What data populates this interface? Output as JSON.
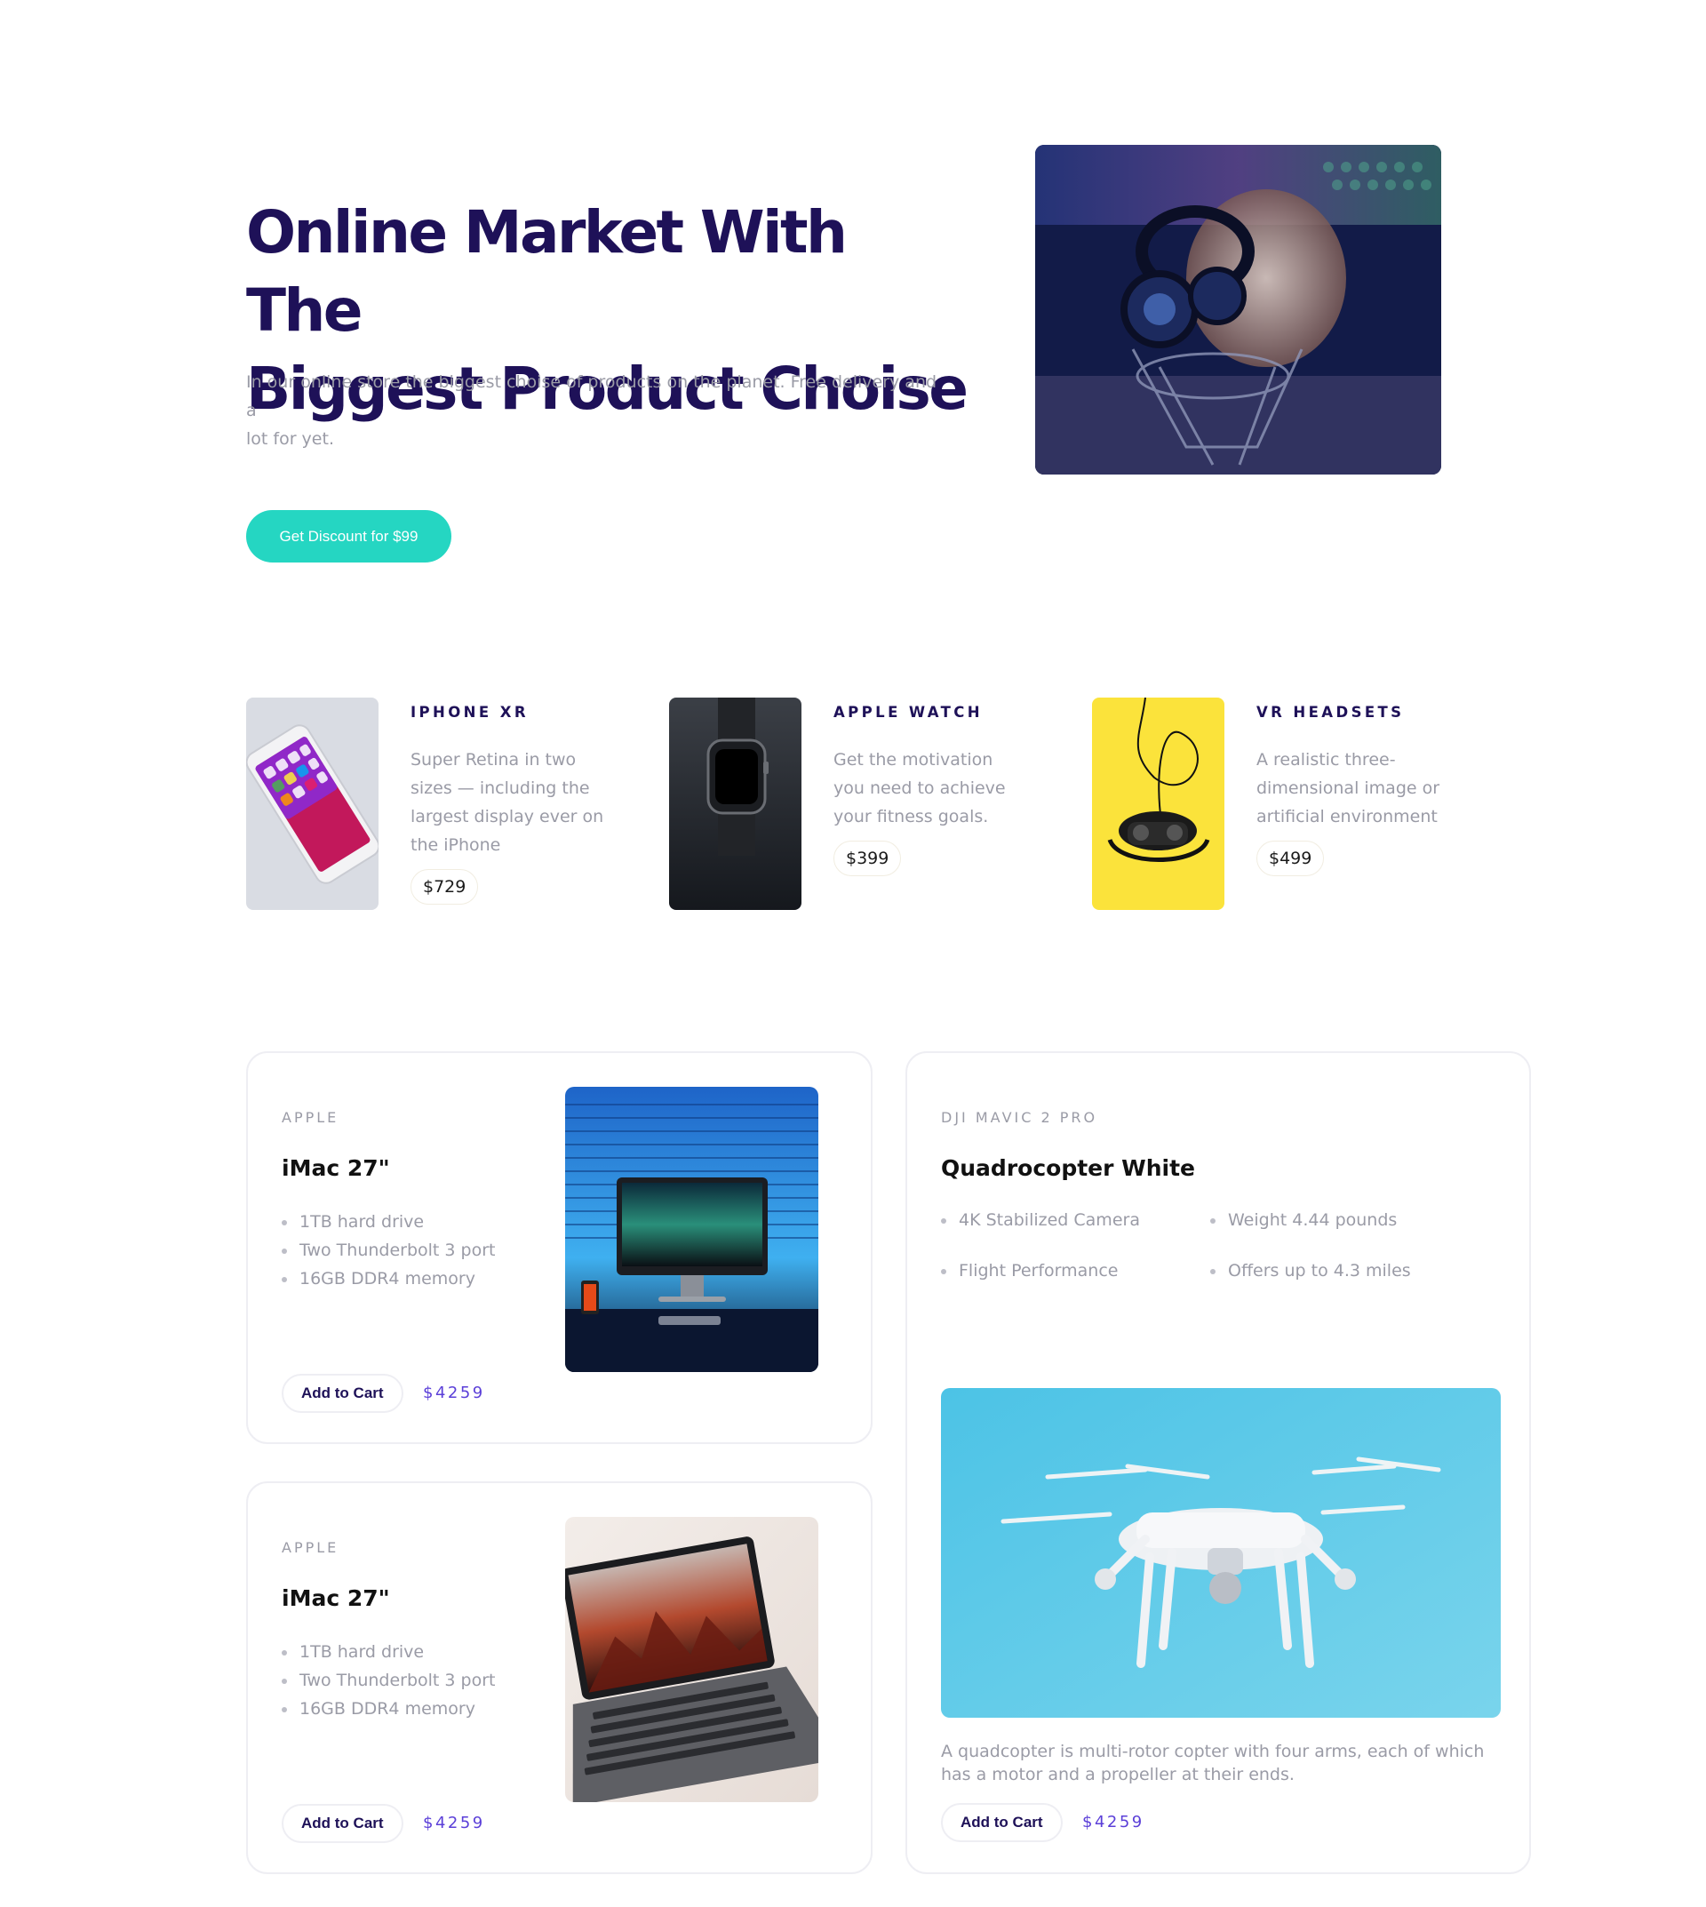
{
  "hero": {
    "title_line1": "Online Market With The",
    "title_line2": "Biggest Product Choise",
    "subtitle_line1": "In our online store the biggest choise of products on the planet. Free delivery and a",
    "subtitle_line2": "lot for yet.",
    "cta_label": "Get Discount for $99",
    "image": "studio-microphone-headphones-photo"
  },
  "featured": [
    {
      "name": "IPHONE XR",
      "desc": [
        "Super Retina in two",
        "sizes — including the",
        "largest display ever on",
        "the iPhone"
      ],
      "price": "$729",
      "image": "iphone-photo"
    },
    {
      "name": "APPLE WATCH",
      "desc": [
        "Get the motivation",
        "you need to achieve",
        "your fitness goals."
      ],
      "price": "$399",
      "image": "apple-watch-photo"
    },
    {
      "name": "VR HEADSETS",
      "desc": [
        "A realistic three-",
        "dimensional image or",
        "artificial environment"
      ],
      "price": "$499",
      "image": "vr-headset-photo"
    }
  ],
  "cards": [
    {
      "brand": "APPLE",
      "title": "iMac 27\"",
      "specs": [
        "1TB hard drive",
        "Two Thunderbolt 3 port",
        "16GB DDR4 memory"
      ],
      "cart_label": "Add to Cart",
      "price": "$4259",
      "image": "imac-desk-photo"
    },
    {
      "brand": "APPLE",
      "title": "iMac 27\"",
      "specs": [
        "1TB hard drive",
        "Two Thunderbolt 3 port",
        "16GB DDR4 memory"
      ],
      "cart_label": "Add to Cart",
      "price": "$4259",
      "image": "macbook-photo"
    }
  ],
  "drone": {
    "brand": "DJI MAVIC 2 PRO",
    "title": "Quadrocopter White",
    "specs": [
      "4K Stabilized Camera",
      "Weight 4.44 pounds",
      "Flight Performance",
      "Offers up to 4.3 miles"
    ],
    "desc_line1": "A quadcopter is multi-rotor copter with four arms, each of which",
    "desc_line2": "has a motor and a propeller at their ends.",
    "cart_label": "Add to Cart",
    "price": "$4259",
    "image": "drone-photo"
  },
  "colors": {
    "title": "#1e1158",
    "accent": "#25d6c2",
    "price": "#5b3fd8",
    "muted": "#9a9ba6"
  }
}
